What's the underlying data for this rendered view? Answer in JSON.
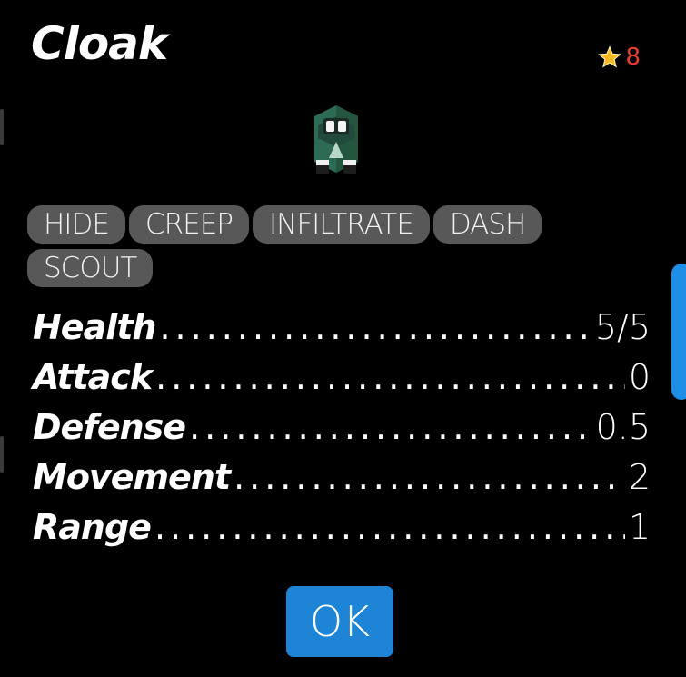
{
  "unit": {
    "name": "Cloak",
    "star_cost": "8"
  },
  "skills": [
    "HIDE",
    "CREEP",
    "INFILTRATE",
    "DASH",
    "SCOUT"
  ],
  "stats": [
    {
      "label": "Health",
      "value": "5/5"
    },
    {
      "label": "Attack",
      "value": "0"
    },
    {
      "label": "Defense",
      "value": "0.5"
    },
    {
      "label": "Movement",
      "value": "2"
    },
    {
      "label": "Range",
      "value": "1"
    }
  ],
  "buttons": {
    "ok_label": "OK"
  },
  "colors": {
    "accent": "#1d84d6",
    "star_count": "#e8402c",
    "tag_bg": "#585858",
    "unit_body": "#2e6b55"
  },
  "icons": {
    "cost": "star-icon",
    "unit": "cloak-unit-sprite"
  }
}
